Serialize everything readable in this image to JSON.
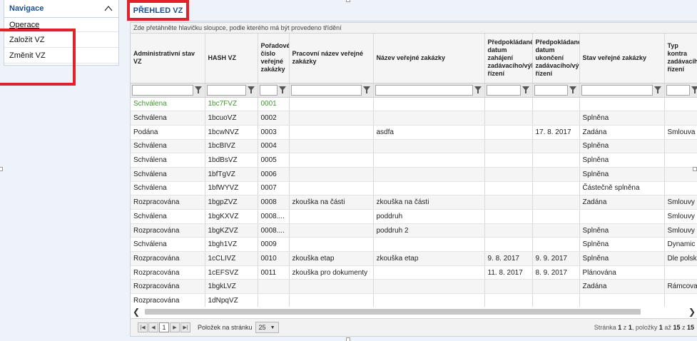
{
  "nav": {
    "title": "Navigace",
    "items": [
      "Operace",
      "Založit VZ",
      "Změnit VZ"
    ]
  },
  "tab": {
    "label": "PŘEHLED VZ"
  },
  "grid": {
    "grouping_hint": "Zde přetáhněte hlavičku sloupce, podle kterého má být provedeno třídění",
    "columns": [
      "Administrativní stav VZ",
      "HASH VZ",
      "Pořadové číslo veřejné zakázky",
      "Pracovní název veřejné zakázky",
      "Název veřejné zakázky",
      "Předpokládané datum zahájení zadávacího/výběr řízení",
      "Předpokládané datum ukončení zadávacího/výběr řízení",
      "Stav veřejné zakázky",
      "Typ kontra zadávacího řízení"
    ],
    "rows": [
      [
        "Schválena",
        "1bc7FVZ",
        "0001",
        "",
        "",
        "",
        "",
        "",
        ""
      ],
      [
        "Schválena",
        "1bcuoVZ",
        "0002",
        "",
        "",
        "",
        "",
        "Splněna",
        ""
      ],
      [
        "Podána",
        "1bcwNVZ",
        "0003",
        "",
        "asdfa",
        "",
        "17. 8. 2017",
        "Zadána",
        "Smlouva"
      ],
      [
        "Schválena",
        "1bcBIVZ",
        "0004",
        "",
        "",
        "",
        "",
        "Splněna",
        ""
      ],
      [
        "Schválena",
        "1bdBsVZ",
        "0005",
        "",
        "",
        "",
        "",
        "Splněna",
        ""
      ],
      [
        "Schválena",
        "1bfTgVZ",
        "0006",
        "",
        "",
        "",
        "",
        "Splněna",
        ""
      ],
      [
        "Schválena",
        "1bfWYVZ",
        "0007",
        "",
        "",
        "",
        "",
        "Částečně splněna",
        ""
      ],
      [
        "Rozpracována",
        "1bgpZVZ",
        "0008",
        "zkouška na části",
        "zkouška na části",
        "",
        "",
        "Zadána",
        "Smlouvy"
      ],
      [
        "Schválena",
        "1bgKXVZ",
        "0008....",
        "",
        "poddruh",
        "",
        "",
        "",
        "Smlouvy"
      ],
      [
        "Rozpracována",
        "1bgKZVZ",
        "0008....",
        "",
        "poddruh 2",
        "",
        "",
        "Splněna",
        "Smlouvy"
      ],
      [
        "Schválena",
        "1bgh1VZ",
        "0009",
        "",
        "",
        "",
        "",
        "Splněna",
        "Dynamic"
      ],
      [
        "Rozpracována",
        "1cCLIVZ",
        "0010",
        "zkouška etap",
        "zkouška etap",
        "9. 8. 2017",
        "9. 9. 2017",
        "Splněna",
        "Dle polsk"
      ],
      [
        "Rozpracována",
        "1cEFSVZ",
        "0011",
        "zkouška pro dokumenty",
        "",
        "11. 8. 2017",
        "8. 9. 2017",
        "Plánována",
        ""
      ],
      [
        "Rozpracována",
        "1bgkLVZ",
        "",
        "",
        "",
        "",
        "",
        "Zadána",
        "Rámcova"
      ],
      [
        "Rozpracována",
        "1dNpqVZ",
        "",
        "",
        "",
        "",
        "",
        "",
        ""
      ]
    ]
  },
  "pager": {
    "current_page": "1",
    "page_size_label": "Položek na stránku",
    "page_size": "25",
    "summary_prefix": "Stránka",
    "page": "1",
    "summary_of": "z",
    "pages": "1",
    "summary_items": ", položky",
    "from": "1",
    "summary_to": "až",
    "to": "15",
    "summary_of2": "z",
    "total": "15"
  },
  "colors": {
    "accent": "#1c4f8c",
    "highlight": "#e0232b",
    "selected_row": "#3e9a2b"
  }
}
